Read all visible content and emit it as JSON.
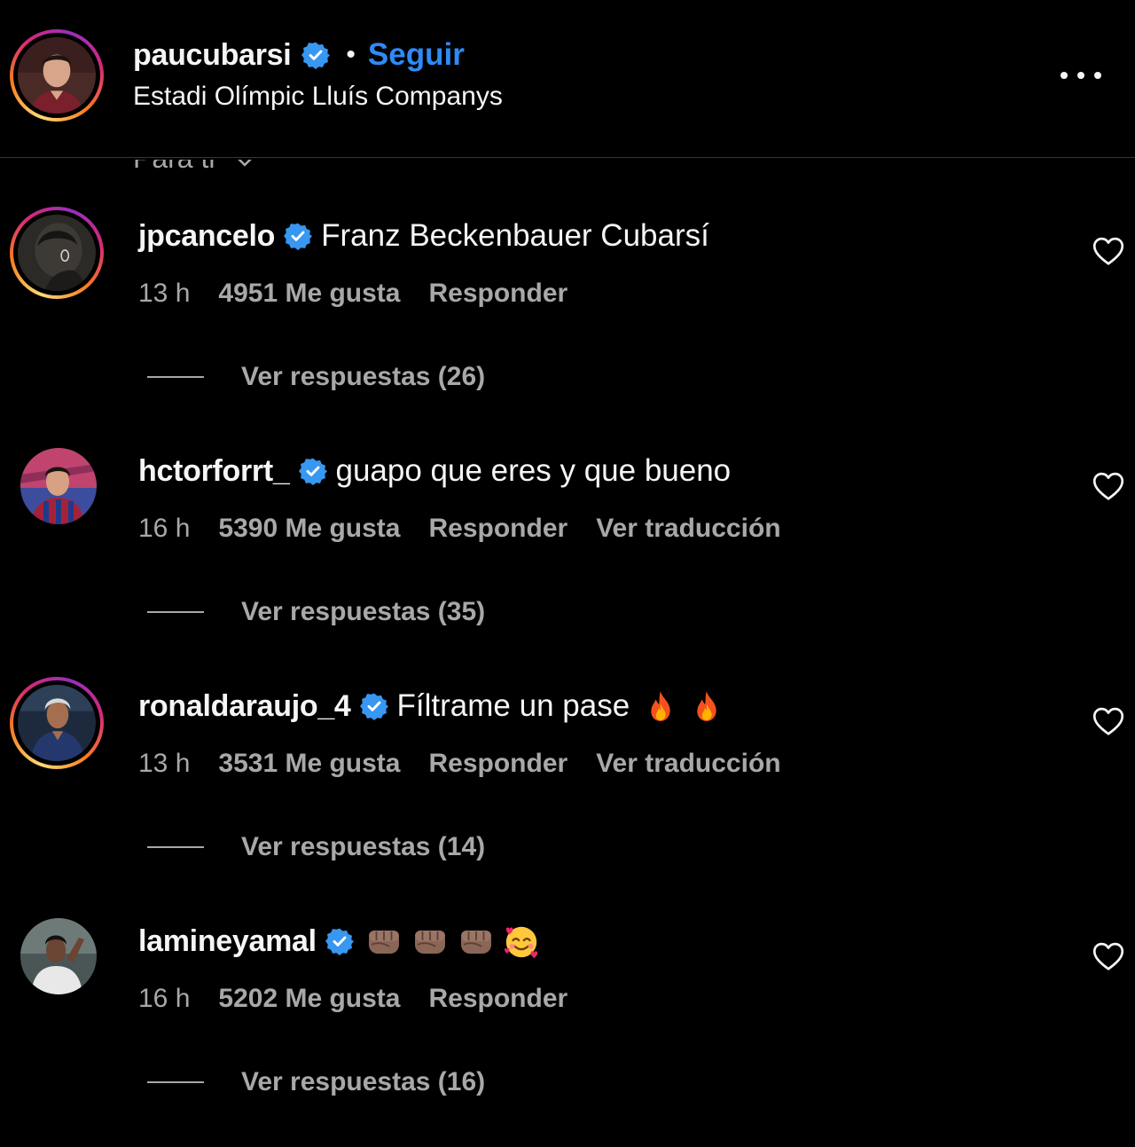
{
  "post_header": {
    "username": "paucubarsi",
    "separator": "•",
    "follow_label": "Seguir",
    "location": "Estadi Olímpic Lluís Companys"
  },
  "sort": {
    "label": "Para ti"
  },
  "comments": [
    {
      "username": "jpcancelo",
      "verified": true,
      "text": "Franz Beckenbauer Cubarsí",
      "time": "13 h",
      "likes": "4951 Me gusta",
      "reply_label": "Responder",
      "replies_label": "Ver respuestas (26)"
    },
    {
      "username": "hctorforrt_",
      "verified": true,
      "text": "guapo que eres y que bueno",
      "time": "16 h",
      "likes": "5390 Me gusta",
      "reply_label": "Responder",
      "translate_label": "Ver traducción",
      "replies_label": "Ver respuestas (35)"
    },
    {
      "username": "ronaldaraujo_4",
      "verified": true,
      "text": "Fíltrame un pase",
      "emojis": [
        "fire",
        "fire"
      ],
      "time": "13 h",
      "likes": "3531 Me gusta",
      "reply_label": "Responder",
      "translate_label": "Ver traducción",
      "replies_label": "Ver respuestas (14)"
    },
    {
      "username": "lamineyamal",
      "verified": true,
      "text": "",
      "emojis": [
        "fist",
        "fist",
        "fist",
        "smiling-face-with-hearts"
      ],
      "time": "16 h",
      "likes": "5202 Me gusta",
      "reply_label": "Responder",
      "replies_label": "Ver respuestas (16)"
    }
  ],
  "colors": {
    "background": "#000000",
    "text": "#f5f5f5",
    "secondary_text": "#a8a8a8",
    "link_blue": "#2f8af5",
    "verified_blue": "#3897f0"
  }
}
